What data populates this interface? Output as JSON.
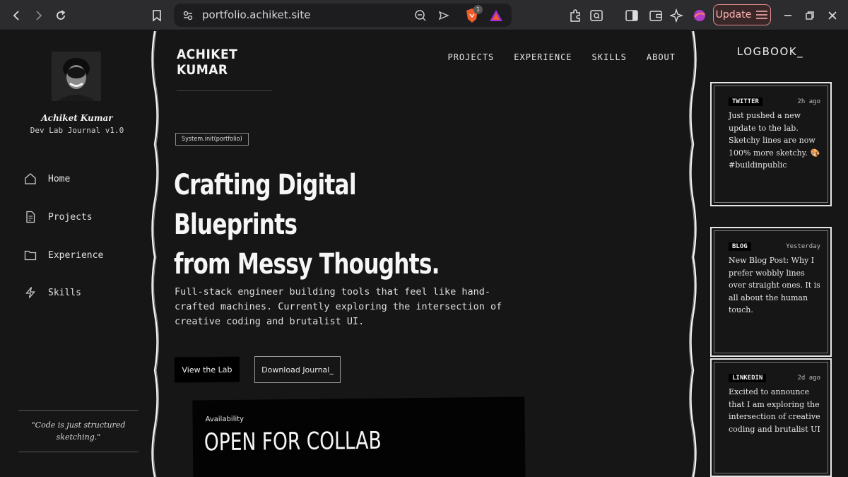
{
  "browser": {
    "url": "portfolio.achiket.site",
    "update_label": "Update",
    "shields_count": "1"
  },
  "sidebar": {
    "user_name": "Achiket Kumar",
    "user_subtitle": "Dev Lab Journal v1.0",
    "nav": [
      {
        "label": "Home",
        "icon": "home-icon"
      },
      {
        "label": "Projects",
        "icon": "document-icon"
      },
      {
        "label": "Experience",
        "icon": "folder-icon"
      },
      {
        "label": "Skills",
        "icon": "lightning-icon"
      }
    ],
    "quote": "\"Code is just structured sketching.\""
  },
  "header": {
    "brand": "ACHIKET KUMAR",
    "nav": [
      "PROJECTS",
      "EXPERIENCE",
      "SKILLS",
      "ABOUT"
    ]
  },
  "hero": {
    "tag": "System.init(portfolio)",
    "title_line1": "Crafting Digital Blueprints",
    "title_line2": "from Messy Thoughts.",
    "description": "Full-stack engineer building tools that feel like hand-crafted machines. Currently exploring the intersection of creative coding and brutalist UI.",
    "primary_button": "View the Lab",
    "secondary_button": "Download Journal_",
    "availability_label": "Availability",
    "availability_title": "OPEN FOR COLLAB"
  },
  "logbook": {
    "title": "LOGBOOK_",
    "entries": [
      {
        "source": "TWITTER",
        "time": "2h ago",
        "text": "Just pushed a new update to the lab. Sketchy lines are now 100% more sketchy. 🎨 #buildinpublic"
      },
      {
        "source": "BLOG",
        "time": "Yesterday",
        "text": "New Blog Post: Why I prefer wobbly lines over straight ones. It is all about the human touch."
      },
      {
        "source": "LINKEDIN",
        "time": "2d ago",
        "text": "Excited to announce that I am exploring the intersection of creative coding and brutalist UI"
      }
    ]
  },
  "colors": {
    "background": "#161616",
    "text": "#e8e8e8",
    "update_accent": "#e08d8d"
  }
}
